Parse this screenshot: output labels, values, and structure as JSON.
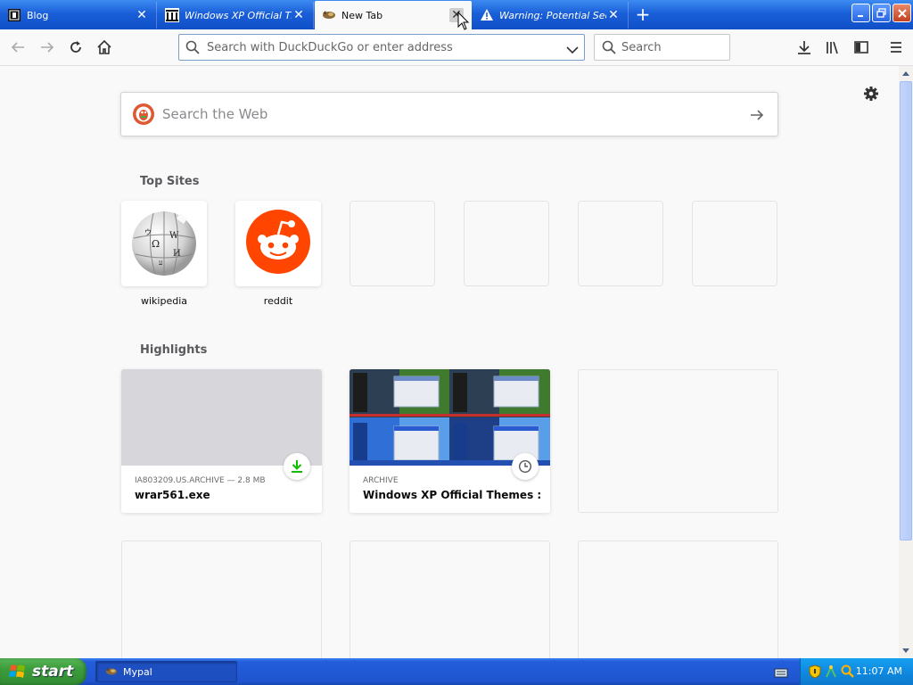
{
  "tabs": [
    {
      "label": "Blog",
      "icon": "blog-favicon",
      "selected": false
    },
    {
      "label": "Windows XP Official The",
      "icon": "archive-favicon",
      "selected": false
    },
    {
      "label": "New Tab",
      "icon": "mypal-favicon",
      "selected": true
    },
    {
      "label": "Warning: Potential Secu",
      "icon": "warning-icon",
      "selected": false
    }
  ],
  "toolbar": {
    "urlbar_placeholder": "Search with DuckDuckGo or enter address",
    "search_placeholder": "Search"
  },
  "newtab": {
    "search_placeholder": "Search the Web",
    "top_sites_title": "Top Sites",
    "highlights_title": "Highlights",
    "top_sites": [
      {
        "label": "wikipedia",
        "icon": "wikipedia-icon"
      },
      {
        "label": "reddit",
        "icon": "reddit-icon"
      },
      {
        "label": ""
      },
      {
        "label": ""
      },
      {
        "label": ""
      },
      {
        "label": ""
      }
    ],
    "highlights": [
      {
        "context": "IA803209.US.ARCHIVE — 2.8 MB",
        "title": "wrar561.exe",
        "badge": "download-icon"
      },
      {
        "context": "ARCHIVE",
        "title": "Windows XP Official Themes : M...",
        "badge": "clock-icon"
      }
    ]
  },
  "taskbar": {
    "start_label": "start",
    "task_label": "Mypal",
    "clock": "11:07 AM"
  },
  "colors": {
    "accent": "#0a84ff",
    "reddit": "#ff4500",
    "ddg": "#de5833",
    "download": "#12bc00"
  }
}
